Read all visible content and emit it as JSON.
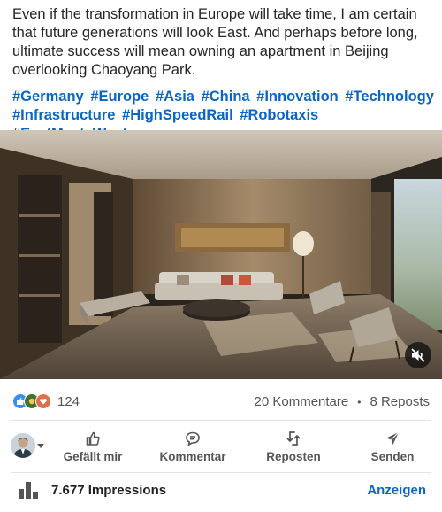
{
  "post": {
    "text_lines": [
      "Even if the transformation in Europe will take time, I am certain",
      "that future generations will look East. And perhaps before long,",
      "ultimate success will mean owning an apartment in Beijing",
      "overlooking Chaoyang Park."
    ],
    "hashtags": [
      "#Germany",
      "#Europe",
      "#Asia",
      "#China",
      "#Innovation",
      "#Technology",
      "#Infrastructure",
      "#HighSpeedRail",
      "#Robotaxis",
      "#EastMeetsWest"
    ]
  },
  "video": {
    "mute_icon": "speaker-muted-icon"
  },
  "social": {
    "reaction_icons": [
      "like-icon",
      "celebrate-icon",
      "love-icon"
    ],
    "reaction_count": "124",
    "comments": "20 Kommentare",
    "separator": "•",
    "reposts": "8 Reposts"
  },
  "actions": {
    "like": "Gefällt mir",
    "comment": "Kommentar",
    "repost": "Reposten",
    "send": "Senden"
  },
  "footer": {
    "impressions": "7.677 Impressions",
    "show": "Anzeigen"
  },
  "colors": {
    "link": "#0a66c2",
    "muted_text": "#545454"
  }
}
